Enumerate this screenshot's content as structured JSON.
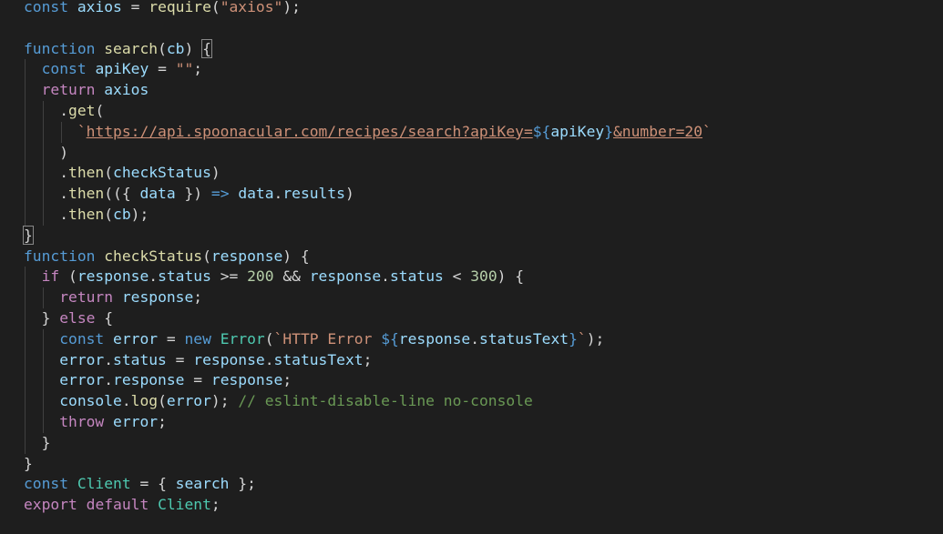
{
  "editor": {
    "colors": {
      "background": "#1e1e1e",
      "keyword": "#569cd6",
      "control": "#c586c0",
      "function": "#dcdcaa",
      "variable": "#9cdcfe",
      "string": "#ce9178",
      "number": "#b5cea8",
      "class": "#4ec9b0",
      "comment": "#6a9955",
      "default": "#d4d4d4"
    },
    "lines": [
      [
        [
          "kw",
          "const"
        ],
        [
          "t",
          " "
        ],
        [
          "var",
          "axios"
        ],
        [
          "t",
          " = "
        ],
        [
          "fn",
          "require"
        ],
        [
          "t",
          "("
        ],
        [
          "str",
          "\"axios\""
        ],
        [
          "t",
          ");"
        ]
      ],
      [],
      [
        [
          "kw",
          "function"
        ],
        [
          "t",
          " "
        ],
        [
          "fn",
          "search"
        ],
        [
          "t",
          "("
        ],
        [
          "var",
          "cb"
        ],
        [
          "t",
          ") "
        ],
        [
          "bm",
          "{"
        ]
      ],
      [
        [
          "t",
          "  "
        ],
        [
          "kw",
          "const"
        ],
        [
          "t",
          " "
        ],
        [
          "var",
          "apiKey"
        ],
        [
          "t",
          " = "
        ],
        [
          "str",
          "\"\""
        ],
        [
          "t",
          ";"
        ]
      ],
      [
        [
          "t",
          "  "
        ],
        [
          "ctl",
          "return"
        ],
        [
          "t",
          " "
        ],
        [
          "var",
          "axios"
        ]
      ],
      [
        [
          "t",
          "    ."
        ],
        [
          "fn",
          "get"
        ],
        [
          "t",
          "("
        ]
      ],
      [
        [
          "t",
          "      "
        ],
        [
          "str",
          "`"
        ],
        [
          "link",
          "https://api.spoonacular.com/recipes/search?apiKey="
        ],
        [
          "kw",
          "${"
        ],
        [
          "var",
          "apiKey"
        ],
        [
          "kw",
          "}"
        ],
        [
          "link",
          "&number=20"
        ],
        [
          "str",
          "`"
        ]
      ],
      [
        [
          "t",
          "    )"
        ]
      ],
      [
        [
          "t",
          "    ."
        ],
        [
          "fn",
          "then"
        ],
        [
          "t",
          "("
        ],
        [
          "var",
          "checkStatus"
        ],
        [
          "t",
          ")"
        ]
      ],
      [
        [
          "t",
          "    ."
        ],
        [
          "fn",
          "then"
        ],
        [
          "t",
          "(({ "
        ],
        [
          "var",
          "data"
        ],
        [
          "t",
          " }) "
        ],
        [
          "kw",
          "=>"
        ],
        [
          "t",
          " "
        ],
        [
          "var",
          "data"
        ],
        [
          "t",
          "."
        ],
        [
          "var",
          "results"
        ],
        [
          "t",
          ")"
        ]
      ],
      [
        [
          "t",
          "    ."
        ],
        [
          "fn",
          "then"
        ],
        [
          "t",
          "("
        ],
        [
          "var",
          "cb"
        ],
        [
          "t",
          ");"
        ]
      ],
      [
        [
          "bm",
          "}"
        ]
      ],
      [
        [
          "kw",
          "function"
        ],
        [
          "t",
          " "
        ],
        [
          "fn",
          "checkStatus"
        ],
        [
          "t",
          "("
        ],
        [
          "var",
          "response"
        ],
        [
          "t",
          ") {"
        ]
      ],
      [
        [
          "t",
          "  "
        ],
        [
          "ctl",
          "if"
        ],
        [
          "t",
          " ("
        ],
        [
          "var",
          "response"
        ],
        [
          "t",
          "."
        ],
        [
          "var",
          "status"
        ],
        [
          "t",
          " >= "
        ],
        [
          "num",
          "200"
        ],
        [
          "t",
          " && "
        ],
        [
          "var",
          "response"
        ],
        [
          "t",
          "."
        ],
        [
          "var",
          "status"
        ],
        [
          "t",
          " < "
        ],
        [
          "num",
          "300"
        ],
        [
          "t",
          ") {"
        ]
      ],
      [
        [
          "t",
          "    "
        ],
        [
          "ctl",
          "return"
        ],
        [
          "t",
          " "
        ],
        [
          "var",
          "response"
        ],
        [
          "t",
          ";"
        ]
      ],
      [
        [
          "t",
          "  } "
        ],
        [
          "ctl",
          "else"
        ],
        [
          "t",
          " {"
        ]
      ],
      [
        [
          "t",
          "    "
        ],
        [
          "kw",
          "const"
        ],
        [
          "t",
          " "
        ],
        [
          "var",
          "error"
        ],
        [
          "t",
          " = "
        ],
        [
          "kw",
          "new"
        ],
        [
          "t",
          " "
        ],
        [
          "cls",
          "Error"
        ],
        [
          "t",
          "("
        ],
        [
          "str",
          "`HTTP Error "
        ],
        [
          "kw",
          "${"
        ],
        [
          "var",
          "response"
        ],
        [
          "t",
          "."
        ],
        [
          "var",
          "statusText"
        ],
        [
          "kw",
          "}"
        ],
        [
          "str",
          "`"
        ],
        [
          "t",
          ");"
        ]
      ],
      [
        [
          "t",
          "    "
        ],
        [
          "var",
          "error"
        ],
        [
          "t",
          "."
        ],
        [
          "var",
          "status"
        ],
        [
          "t",
          " = "
        ],
        [
          "var",
          "response"
        ],
        [
          "t",
          "."
        ],
        [
          "var",
          "statusText"
        ],
        [
          "t",
          ";"
        ]
      ],
      [
        [
          "t",
          "    "
        ],
        [
          "var",
          "error"
        ],
        [
          "t",
          "."
        ],
        [
          "var",
          "response"
        ],
        [
          "t",
          " = "
        ],
        [
          "var",
          "response"
        ],
        [
          "t",
          ";"
        ]
      ],
      [
        [
          "t",
          "    "
        ],
        [
          "var",
          "console"
        ],
        [
          "t",
          "."
        ],
        [
          "fn",
          "log"
        ],
        [
          "t",
          "("
        ],
        [
          "var",
          "error"
        ],
        [
          "t",
          "); "
        ],
        [
          "cmt",
          "// eslint-disable-line no-console"
        ]
      ],
      [
        [
          "t",
          "    "
        ],
        [
          "ctl",
          "throw"
        ],
        [
          "t",
          " "
        ],
        [
          "var",
          "error"
        ],
        [
          "t",
          ";"
        ]
      ],
      [
        [
          "t",
          "  }"
        ]
      ],
      [
        [
          "t",
          "}"
        ]
      ],
      [
        [
          "kw",
          "const"
        ],
        [
          "t",
          " "
        ],
        [
          "cls",
          "Client"
        ],
        [
          "t",
          " = { "
        ],
        [
          "var",
          "search"
        ],
        [
          "t",
          " };"
        ]
      ],
      [
        [
          "ctl",
          "export"
        ],
        [
          "t",
          " "
        ],
        [
          "ctl",
          "default"
        ],
        [
          "t",
          " "
        ],
        [
          "cls",
          "Client"
        ],
        [
          "t",
          ";"
        ]
      ]
    ]
  }
}
